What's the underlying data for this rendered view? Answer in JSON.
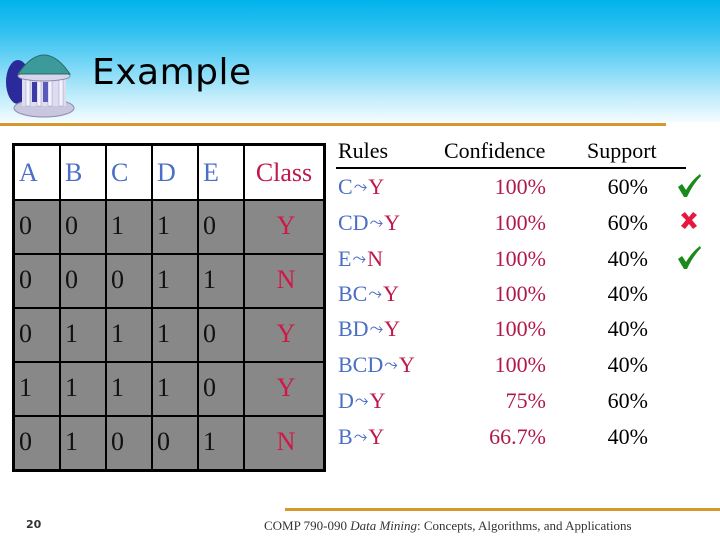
{
  "slide": {
    "title": "Example",
    "page_number": "20",
    "footer": {
      "course": "COMP 790-090 ",
      "italic": "Data Mining",
      "rest": ": Concepts, Algorithms, and Applications"
    }
  },
  "colors": {
    "accent_rule": "#d5982e",
    "attribute_blue": "#4a6fc5",
    "class_red": "#c0184a",
    "row_gray": "#888888",
    "check_green": "#1a8a1a",
    "cross_red": "#e8163c"
  },
  "table": {
    "headers": [
      "A",
      "B",
      "C",
      "D",
      "E",
      "Class"
    ],
    "rows": [
      [
        "0",
        "0",
        "1",
        "1",
        "0",
        "Y"
      ],
      [
        "0",
        "0",
        "0",
        "1",
        "1",
        "N"
      ],
      [
        "0",
        "1",
        "1",
        "1",
        "0",
        "Y"
      ],
      [
        "1",
        "1",
        "1",
        "1",
        "0",
        "Y"
      ],
      [
        "0",
        "1",
        "0",
        "0",
        "1",
        "N"
      ]
    ]
  },
  "rules": {
    "headers": {
      "rules": "Rules",
      "confidence": "Confidence",
      "support": "Support"
    },
    "arrow_icon": "implies-arrow-icon",
    "arrow_glyph": "⤳",
    "items": [
      {
        "lhs": "C",
        "rhs": "Y",
        "confidence": "100%",
        "support": "60%",
        "mark": "check"
      },
      {
        "lhs": "CD",
        "rhs": "Y",
        "confidence": "100%",
        "support": "60%",
        "mark": "cross"
      },
      {
        "lhs": "E",
        "rhs": "N",
        "confidence": "100%",
        "support": "40%",
        "mark": "check"
      },
      {
        "lhs": "BC",
        "rhs": "Y",
        "confidence": "100%",
        "support": "40%",
        "mark": ""
      },
      {
        "lhs": "BD",
        "rhs": "Y",
        "confidence": "100%",
        "support": "40%",
        "mark": ""
      },
      {
        "lhs": "BCD",
        "rhs": "Y",
        "confidence": "100%",
        "support": "40%",
        "mark": ""
      },
      {
        "lhs": "D",
        "rhs": "Y",
        "confidence": "75%",
        "support": "60%",
        "mark": ""
      },
      {
        "lhs": "B",
        "rhs": "Y",
        "confidence": "66.7%",
        "support": "40%",
        "mark": ""
      }
    ]
  }
}
